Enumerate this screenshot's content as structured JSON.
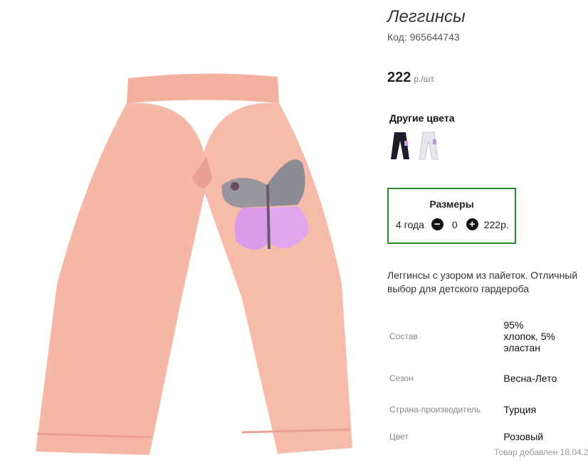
{
  "product": {
    "title": "Леггинсы",
    "code": "Код: 965644743",
    "price_amount": "222",
    "price_unit": "р./шт.",
    "other_colors_heading": "Другие цвета",
    "other_colors": [
      {
        "name": "black-leggings",
        "color": "#1c1f2a"
      },
      {
        "name": "white-leggings",
        "color": "#e6e6ec"
      }
    ],
    "image_colors": {
      "fabric": "#f6b8a6",
      "fabric_shade": "#e9a290",
      "sequin_pink": "#d99ae8",
      "sequin_grey": "#8c8c94"
    }
  },
  "sizes": {
    "title": "Размеры",
    "rows": [
      {
        "size": "4 года",
        "minus": "−",
        "qty": "0",
        "plus": "+",
        "price": "222р."
      }
    ],
    "border_color": "#2b8a2b"
  },
  "description": "Леггинсы с узором из пайеток. Отличный выбор для детского гардероба",
  "attributes": [
    {
      "name": "Состав",
      "value": "95% хлопок, 5% эластан"
    },
    {
      "name": "Сезон",
      "value": "Весна-Лето"
    },
    {
      "name": "Страна-производитель",
      "value": "Турция"
    },
    {
      "name": "Цвет",
      "value": "Розовый"
    }
  ],
  "added_text": "Товар добавлен 18.04.2"
}
